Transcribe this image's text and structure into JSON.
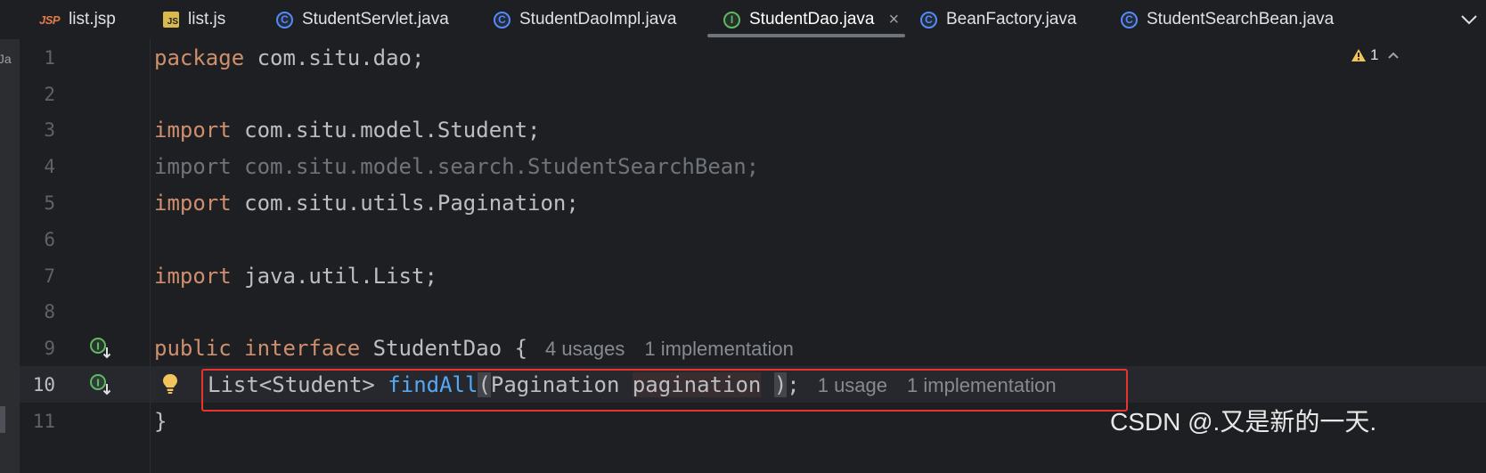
{
  "tabs": [
    {
      "label": "list.jsp",
      "icon": "jsp-file-icon",
      "icon_text": "JSP"
    },
    {
      "label": "list.js",
      "icon": "js-file-icon",
      "icon_text": "JS"
    },
    {
      "label": "StudentServlet.java",
      "icon": "class-icon",
      "icon_text": "C"
    },
    {
      "label": "StudentDaoImpl.java",
      "icon": "class-icon",
      "icon_text": "C"
    },
    {
      "label": "StudentDao.java",
      "icon": "interface-icon",
      "icon_text": "I",
      "active": true
    },
    {
      "label": "BeanFactory.java",
      "icon": "class-icon",
      "icon_text": "C"
    },
    {
      "label": "StudentSearchBean.java",
      "icon": "class-icon",
      "icon_text": "C"
    }
  ],
  "tab_close": "×",
  "tabs_dropdown": "⌄",
  "left_strip_text": "\\Ja",
  "warnings": {
    "count": "1",
    "expand": "⌃"
  },
  "editor": {
    "line_numbers": [
      "1",
      "2",
      "3",
      "4",
      "5",
      "6",
      "7",
      "8",
      "9",
      "10",
      "11"
    ],
    "line1": {
      "kw": "package",
      "rest": " com.situ.dao;"
    },
    "line3": {
      "kw": "import",
      "rest": " com.situ.model.Student;"
    },
    "line4": {
      "text": "import com.situ.model.search.StudentSearchBean;"
    },
    "line5": {
      "kw": "import",
      "rest": " com.situ.utils.Pagination;"
    },
    "line7": {
      "kw": "import",
      "rest": " java.util.List;"
    },
    "line9": {
      "kw1": "public",
      "kw2": "interface",
      "rest": " StudentDao {",
      "usages": "4 usages",
      "impl": "1 implementation"
    },
    "line10": {
      "type": "List<Student> ",
      "method": "findAll",
      "open": "(",
      "ptype": "Pagination ",
      "param": "pagination",
      "space": " ",
      "close": ")",
      "semi": ";",
      "usages": "1 usage",
      "impl": "1 implementation"
    },
    "line11": {
      "text": "}"
    }
  },
  "watermark": "CSDN @.又是新的一天."
}
